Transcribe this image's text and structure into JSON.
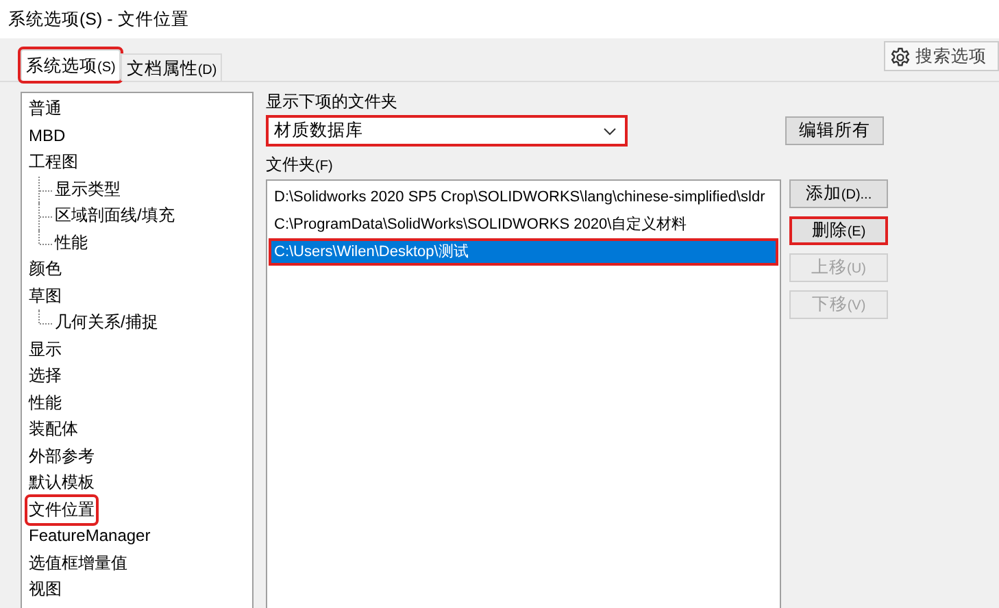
{
  "window": {
    "title": "系统选项(S) - 文件位置"
  },
  "tabs": [
    {
      "label": "系统选项",
      "key": "(S)",
      "selected": true,
      "highlighted": true
    },
    {
      "label": "文档属性",
      "key": "(D)",
      "selected": false,
      "highlighted": false
    }
  ],
  "search": {
    "placeholder": "搜索选项"
  },
  "tree": [
    {
      "label": "普通",
      "highlighted": false
    },
    {
      "label": "MBD",
      "highlighted": false
    },
    {
      "label": "工程图",
      "highlighted": false,
      "children": [
        {
          "label": "显示类型",
          "highlighted": false
        },
        {
          "label": "区域剖面线/填充",
          "highlighted": false
        },
        {
          "label": "性能",
          "highlighted": false
        }
      ]
    },
    {
      "label": "颜色",
      "highlighted": false
    },
    {
      "label": "草图",
      "highlighted": false,
      "children": [
        {
          "label": "几何关系/捕捉",
          "highlighted": false
        }
      ]
    },
    {
      "label": "显示",
      "highlighted": false
    },
    {
      "label": "选择",
      "highlighted": false
    },
    {
      "label": "性能",
      "highlighted": false
    },
    {
      "label": "装配体",
      "highlighted": false
    },
    {
      "label": "外部参考",
      "highlighted": false
    },
    {
      "label": "默认模板",
      "highlighted": false
    },
    {
      "label": "文件位置",
      "highlighted": true
    },
    {
      "label": "FeatureManager",
      "highlighted": false
    },
    {
      "label": "选值框增量值",
      "highlighted": false
    },
    {
      "label": "视图",
      "highlighted": false
    }
  ],
  "show_folders_for": {
    "label": "显示下项的文件夹",
    "value": "材质数据库",
    "highlighted": true
  },
  "edit_all_button": {
    "label": "编辑所有",
    "disabled": false
  },
  "folders": {
    "label": "文件夹",
    "key": "(F)",
    "rows": [
      {
        "path": "D:\\Solidworks 2020 SP5 Crop\\SOLIDWORKS\\lang\\chinese-simplified\\sldr",
        "selected": false,
        "highlighted": false
      },
      {
        "path": "C:\\ProgramData\\SolidWorks\\SOLIDWORKS 2020\\自定义材料",
        "selected": false,
        "highlighted": false
      },
      {
        "path": "C:\\Users\\Wilen\\Desktop\\测试",
        "selected": true,
        "highlighted": true
      }
    ]
  },
  "folder_buttons": [
    {
      "label": "添加",
      "key": "(D)...",
      "disabled": false,
      "highlighted": false
    },
    {
      "label": "删除",
      "key": "(E)",
      "disabled": false,
      "highlighted": true
    },
    {
      "label": "上移",
      "key": "(U)",
      "disabled": true,
      "highlighted": false
    },
    {
      "label": "下移",
      "key": "(V)",
      "disabled": true,
      "highlighted": false
    }
  ]
}
